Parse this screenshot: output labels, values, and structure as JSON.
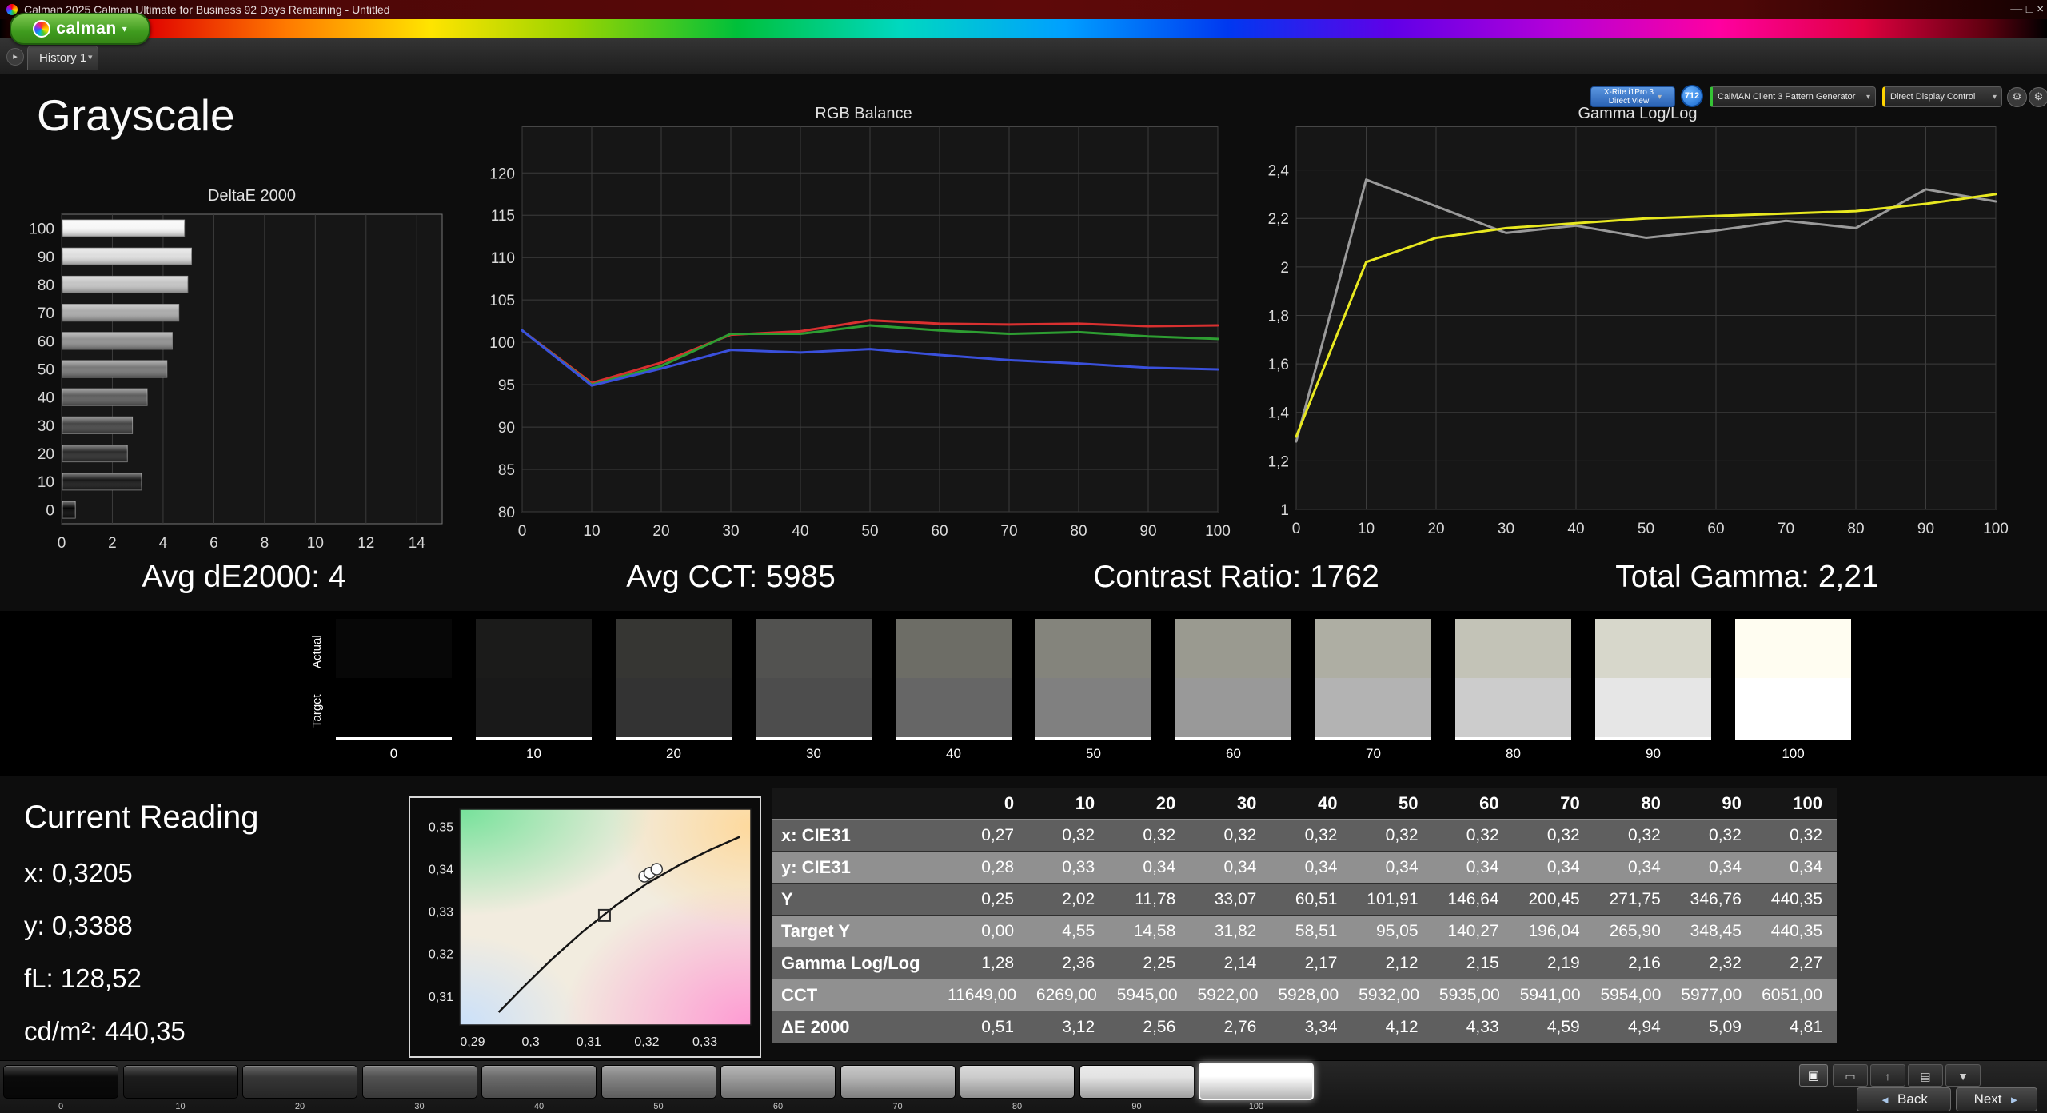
{
  "window": {
    "title": "Calman 2025 Calman Ultimate for Business 92 Days Remaining  - Untitled"
  },
  "icons": {
    "chevron_down": "▾",
    "history_arrow": "▸",
    "gear": "⚙",
    "pattern_window": "▣",
    "monitor": "▭",
    "up_arrow": "↑",
    "printer": "▤",
    "export": "▼",
    "back_arrow": "◄",
    "next_arrow": "►",
    "minimize": "—",
    "maximize": "□",
    "close": "×"
  },
  "brand": {
    "logo_text": "calman"
  },
  "tabs": {
    "history": "History 1"
  },
  "devices": {
    "meter_line1": "X-Rite i1Pro 3",
    "meter_line2": "Direct View",
    "badge": "712",
    "pattern_gen": "CalMAN Client 3 Pattern Generator",
    "display_ctrl": "Direct Display Control"
  },
  "page": {
    "heading": "Grayscale"
  },
  "stats": [
    {
      "label": "Avg dE2000:",
      "value": "4"
    },
    {
      "label": "Avg CCT:",
      "value": "5985"
    },
    {
      "label": "Contrast Ratio:",
      "value": "1762"
    },
    {
      "label": "Total Gamma:",
      "value": "2,21"
    }
  ],
  "swatches": {
    "row_labels": [
      "Actual",
      "Target"
    ],
    "levels": [
      "0",
      "10",
      "20",
      "30",
      "40",
      "50",
      "60",
      "70",
      "80",
      "90",
      "100"
    ],
    "actual": [
      "#070707",
      "#1b1b1a",
      "#363633",
      "#525250",
      "#6d6d66",
      "#84847c",
      "#9a9a90",
      "#aeaea3",
      "#c3c3b7",
      "#d7d7cb",
      "#fffdf1"
    ],
    "target": [
      "#000000",
      "#191919",
      "#333333",
      "#4d4d4d",
      "#666666",
      "#808080",
      "#999999",
      "#b3b3b3",
      "#cccccc",
      "#e6e6e6",
      "#ffffff"
    ]
  },
  "reading": {
    "heading": "Current Reading",
    "lines": [
      {
        "label": "x:",
        "value": "0,3205"
      },
      {
        "label": "y:",
        "value": "0,3388"
      },
      {
        "label": "fL:",
        "value": "128,52"
      },
      {
        "label": "cd/m²:",
        "value": "440,35"
      }
    ]
  },
  "table": {
    "corner": "",
    "columns": [
      "0",
      "10",
      "20",
      "30",
      "40",
      "50",
      "60",
      "70",
      "80",
      "90",
      "100"
    ],
    "rows": [
      {
        "label": "x: CIE31",
        "values": [
          "0,27",
          "0,32",
          "0,32",
          "0,32",
          "0,32",
          "0,32",
          "0,32",
          "0,32",
          "0,32",
          "0,32",
          "0,32"
        ]
      },
      {
        "label": "y: CIE31",
        "values": [
          "0,28",
          "0,33",
          "0,34",
          "0,34",
          "0,34",
          "0,34",
          "0,34",
          "0,34",
          "0,34",
          "0,34",
          "0,34"
        ]
      },
      {
        "label": "Y",
        "values": [
          "0,25",
          "2,02",
          "11,78",
          "33,07",
          "60,51",
          "101,91",
          "146,64",
          "200,45",
          "271,75",
          "346,76",
          "440,35"
        ]
      },
      {
        "label": "Target Y",
        "values": [
          "0,00",
          "4,55",
          "14,58",
          "31,82",
          "58,51",
          "95,05",
          "140,27",
          "196,04",
          "265,90",
          "348,45",
          "440,35"
        ]
      },
      {
        "label": "Gamma Log/Log",
        "values": [
          "1,28",
          "2,36",
          "2,25",
          "2,14",
          "2,17",
          "2,12",
          "2,15",
          "2,19",
          "2,16",
          "2,32",
          "2,27"
        ]
      },
      {
        "label": "CCT",
        "values": [
          "11649,00",
          "6269,00",
          "5945,00",
          "5922,00",
          "5928,00",
          "5932,00",
          "5935,00",
          "5941,00",
          "5954,00",
          "5977,00",
          "6051,00"
        ]
      },
      {
        "label": "ΔE 2000",
        "values": [
          "0,51",
          "3,12",
          "2,56",
          "2,76",
          "3,34",
          "4,12",
          "4,33",
          "4,59",
          "4,94",
          "5,09",
          "4,81"
        ]
      }
    ]
  },
  "pattern_bar": {
    "levels": [
      "0",
      "10",
      "20",
      "30",
      "40",
      "50",
      "60",
      "70",
      "80",
      "90",
      "100"
    ],
    "colors": [
      "#0a0a0a",
      "#1c1c1c",
      "#363636",
      "#515151",
      "#6b6b6b",
      "#858585",
      "#9e9e9e",
      "#b5b5b5",
      "#cccccc",
      "#e3e3e3",
      "#ffffff"
    ],
    "selected_index": 10,
    "back": "Back",
    "next": "Next"
  },
  "chart_data": [
    {
      "id": "deltae",
      "type": "bar",
      "orientation": "horizontal",
      "title": "DeltaE 2000",
      "categories": [
        100,
        90,
        80,
        70,
        60,
        50,
        40,
        30,
        20,
        10,
        0
      ],
      "values": [
        4.81,
        5.09,
        4.94,
        4.59,
        4.33,
        4.12,
        3.34,
        2.76,
        2.56,
        3.12,
        0.51
      ],
      "bar_colors": [
        "#f7f7f7",
        "#dedede",
        "#c4c4c4",
        "#ababab",
        "#919191",
        "#787878",
        "#5e5e5e",
        "#454545",
        "#2b2b2b",
        "#181818",
        "#050505"
      ],
      "xlim": [
        0,
        15
      ],
      "xticks": [
        0,
        2,
        4,
        6,
        8,
        10,
        12,
        14
      ],
      "grid": "vertical",
      "legend": "none"
    },
    {
      "id": "rgb",
      "type": "line",
      "title": "RGB Balance",
      "x": [
        0,
        10,
        20,
        30,
        40,
        50,
        60,
        70,
        80,
        90,
        100
      ],
      "series": [
        {
          "name": "Red",
          "color": "#d83030",
          "values": [
            101.4,
            95.2,
            97.6,
            100.9,
            101.3,
            102.6,
            102.2,
            102.1,
            102.2,
            101.9,
            102.0
          ]
        },
        {
          "name": "Green",
          "color": "#2e9e32",
          "values": [
            101.4,
            95.0,
            97.2,
            101.0,
            101.0,
            102.0,
            101.4,
            101.0,
            101.2,
            100.7,
            100.4
          ]
        },
        {
          "name": "Blue",
          "color": "#3a50dc",
          "values": [
            101.4,
            94.9,
            96.9,
            99.1,
            98.8,
            99.2,
            98.5,
            97.9,
            97.5,
            97.0,
            96.8
          ]
        }
      ],
      "xlim": [
        0,
        100
      ],
      "ylim": [
        80,
        125.5
      ],
      "xticks": [
        0,
        10,
        20,
        30,
        40,
        50,
        60,
        70,
        80,
        90,
        100
      ],
      "yticks": [
        80,
        85,
        90,
        95,
        100,
        105,
        110,
        115,
        120
      ],
      "grid": "both",
      "legend": "none"
    },
    {
      "id": "gamma",
      "type": "line",
      "title": "Gamma Log/Log",
      "x": [
        0,
        10,
        20,
        30,
        40,
        50,
        60,
        70,
        80,
        90,
        100
      ],
      "series": [
        {
          "name": "Measured Gamma",
          "color": "#9a9a9a",
          "values": [
            1.28,
            2.36,
            2.25,
            2.14,
            2.17,
            2.12,
            2.15,
            2.19,
            2.16,
            2.32,
            2.27
          ]
        },
        {
          "name": "Target Gamma",
          "color": "#e8e820",
          "values": [
            1.3,
            2.02,
            2.12,
            2.16,
            2.18,
            2.2,
            2.21,
            2.22,
            2.23,
            2.26,
            2.3
          ]
        }
      ],
      "xlim": [
        0,
        100
      ],
      "ylim": [
        1,
        2.58
      ],
      "xticks": [
        0,
        10,
        20,
        30,
        40,
        50,
        60,
        70,
        80,
        90,
        100
      ],
      "yticks": [
        1,
        1.2,
        1.4,
        1.6,
        1.8,
        2,
        2.2,
        2.4
      ],
      "ytick_labels": [
        "1",
        "1,2",
        "1,4",
        "1,6",
        "1,8",
        "2",
        "2,2",
        "2,4"
      ],
      "grid": "both",
      "legend": "none"
    },
    {
      "id": "cie",
      "type": "scatter",
      "title": "CIE Chromaticity",
      "xlim": [
        0.2878,
        0.3379
      ],
      "ylim": [
        0.3032,
        0.354
      ],
      "xticks": [
        0.29,
        0.3,
        0.31,
        0.32,
        0.33
      ],
      "xtick_labels": [
        "0,29",
        "0,3",
        "0,31",
        "0,32",
        "0,33"
      ],
      "yticks": [
        0.31,
        0.32,
        0.33,
        0.34,
        0.35
      ],
      "ytick_labels": [
        "0,31",
        "0,32",
        "0,33",
        "0,34",
        "0,35"
      ],
      "locus": [
        [
          0.2945,
          0.3062
        ],
        [
          0.2985,
          0.3118
        ],
        [
          0.3035,
          0.3185
        ],
        [
          0.309,
          0.3252
        ],
        [
          0.3145,
          0.3312
        ],
        [
          0.32,
          0.3365
        ],
        [
          0.3255,
          0.3408
        ],
        [
          0.331,
          0.3445
        ],
        [
          0.336,
          0.3475
        ]
      ],
      "target_point": {
        "x": 0.3127,
        "y": 0.329
      },
      "measured_points": [
        {
          "x": 0.3196,
          "y": 0.3382
        },
        {
          "x": 0.3205,
          "y": 0.339
        },
        {
          "x": 0.3217,
          "y": 0.3399
        }
      ]
    }
  ]
}
